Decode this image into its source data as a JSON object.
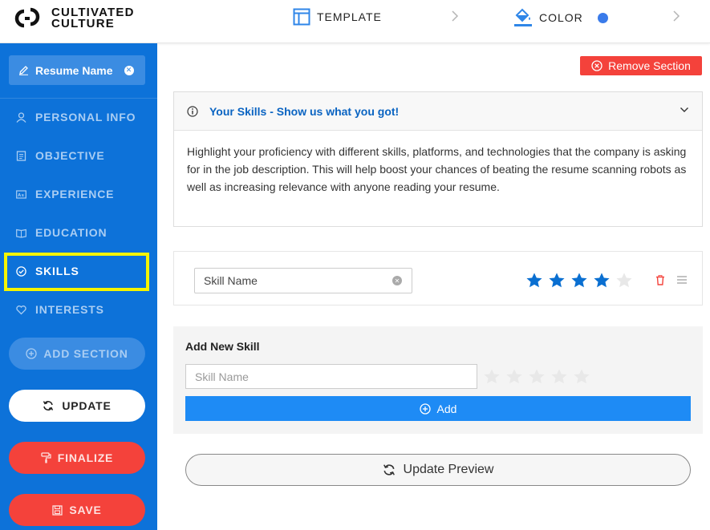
{
  "brand": {
    "line1": "CULTIVATED",
    "line2": "CULTURE"
  },
  "steps": {
    "template_label": "TEMPLATE",
    "color_label": "COLOR",
    "color_swatch": "#3a7bea"
  },
  "sidebar": {
    "resume_name": "Resume Name",
    "items": [
      {
        "label": "PERSONAL INFO",
        "icon": "person-icon"
      },
      {
        "label": "OBJECTIVE",
        "icon": "document-icon"
      },
      {
        "label": "EXPERIENCE",
        "icon": "id-card-icon"
      },
      {
        "label": "EDUCATION",
        "icon": "book-icon"
      },
      {
        "label": "SKILLS",
        "icon": "check-circle-icon",
        "active": true
      },
      {
        "label": "INTERESTS",
        "icon": "heart-icon"
      }
    ],
    "add_section_label": "ADD SECTION",
    "update_label": "UPDATE",
    "finalize_label": "FINALIZE",
    "save_label": "SAVE"
  },
  "main": {
    "remove_section_label": "Remove Section",
    "info": {
      "title": "Your Skills - Show us what you got!",
      "body": "Highlight your proficiency with different skills, platforms, and technologies that the company is asking for in the job description. This will help boost your chances of beating the resume scanning robots as well as increasing relevance with anyone reading your resume."
    },
    "skills": [
      {
        "name": "Skill Name",
        "rating": 4,
        "max": 5
      }
    ],
    "add_new": {
      "title": "Add New Skill",
      "placeholder": "Skill Name",
      "rating": 0,
      "add_label": "Add"
    },
    "update_preview_label": "Update Preview"
  },
  "colors": {
    "primary": "#0d72d9",
    "danger": "#f4423b",
    "accent": "#1e8bf5",
    "highlight": "#f4f400",
    "star_active": "#0a6fd1",
    "star_inactive": "#e8e8e8"
  }
}
